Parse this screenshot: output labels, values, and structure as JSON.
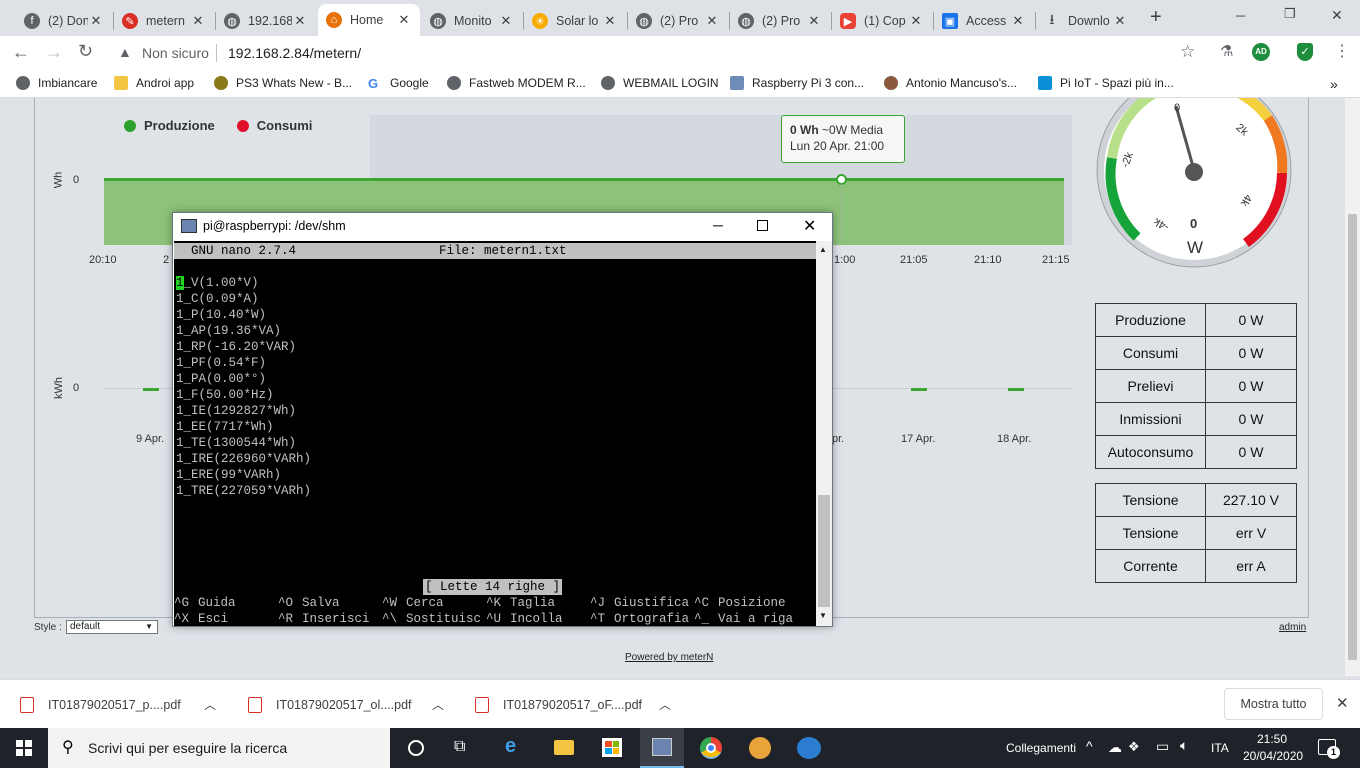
{
  "tabs": [
    {
      "label": "(2) Don",
      "icon": "facebook-icon",
      "color": "#5f6368"
    },
    {
      "label": "metern",
      "icon": "edit-icon",
      "color": "#d93025"
    },
    {
      "label": "192.168",
      "icon": "globe-icon",
      "color": "#5f6368"
    },
    {
      "label": "Home",
      "icon": "home-icon",
      "color": "#e8710a"
    },
    {
      "label": "Monito",
      "icon": "globe-icon",
      "color": "#5f6368"
    },
    {
      "label": "Solar lo",
      "icon": "sun-icon",
      "color": "#f9ab00"
    },
    {
      "label": "(2) Pro",
      "icon": "globe-icon",
      "color": "#5f6368"
    },
    {
      "label": "(2) Pro",
      "icon": "globe-icon",
      "color": "#5f6368"
    },
    {
      "label": "(1) Cop",
      "icon": "youtube-icon",
      "color": "#ea4335"
    },
    {
      "label": "Access",
      "icon": "monitor-icon",
      "color": "#1a73e8"
    },
    {
      "label": "Downlo",
      "icon": "download-icon",
      "color": "#3c4043"
    }
  ],
  "new_tab": "+",
  "window_controls": {
    "minimize": "─",
    "restore": "❐",
    "close": "✕"
  },
  "toolbar": {
    "not_secure": "Non sicuro",
    "url": "192.168.2.84/metern/",
    "profile": "AD"
  },
  "bookmarks": [
    "Imbiancare",
    "Androi app",
    "PS3 Whats New - B...",
    "Google",
    "Fastweb MODEM R...",
    "WEBMAIL LOGIN",
    "Raspberry Pi 3 con...",
    "Antonio Mancuso's...",
    "Pi IoT - Spazi più in..."
  ],
  "bookmarks_more": "»",
  "chart": {
    "legend": [
      {
        "label": "Produzione",
        "color": "#2ca02c"
      },
      {
        "label": "Consumi",
        "color": "#e0102a"
      }
    ],
    "top_ylabel": "Wh",
    "top_ytick": "0",
    "top_xticks_left": [
      "20:10",
      "2"
    ],
    "top_xticks_right": [
      "1:00",
      "21:05",
      "21:10",
      "21:15"
    ],
    "tooltip": {
      "bold": "0 Wh",
      "rest": " ~0W Media",
      "line2": "Lun 20 Apr. 21:00"
    },
    "bottom_ylabel": "kWh",
    "bottom_ytick": "0",
    "bottom_xticks_left": [
      "9 Apr."
    ],
    "bottom_xticks_right": [
      "pr.",
      "17 Apr.",
      "18 Apr."
    ]
  },
  "gauge": {
    "labels": [
      "0",
      "2k",
      "4k",
      "-2k",
      "-4k"
    ],
    "value": "0",
    "unit": "W"
  },
  "table1": [
    [
      "Produzione",
      "0 W"
    ],
    [
      "Consumi",
      "0 W"
    ],
    [
      "Prelievi",
      "0 W"
    ],
    [
      "Inmissioni",
      "0 W"
    ],
    [
      "Autoconsumo",
      "0 W"
    ]
  ],
  "table2": [
    [
      "Tensione",
      "227.10 V"
    ],
    [
      "Tensione",
      "err V"
    ],
    [
      "Corrente",
      "err A"
    ]
  ],
  "style_label": "Style :",
  "style_value": "default",
  "admin_link": "admin",
  "powered_by": "Powered by meterN",
  "terminal": {
    "title": "pi@raspberrypi: /dev/shm",
    "nano_version": "GNU nano 2.7.4",
    "file": "File: metern1.txt",
    "cursor_char": "1",
    "lines": [
      "_V(1.00*V)",
      "1_C(0.09*A)",
      "1_P(10.40*W)",
      "1_AP(19.36*VA)",
      "1_RP(-16.20*VAR)",
      "1_PF(0.54*F)",
      "1_PA(0.00*°)",
      "1_F(50.00*Hz)",
      "1_IE(1292827*Wh)",
      "1_EE(7717*Wh)",
      "1_TE(1300544*Wh)",
      "1_IRE(226960*VARh)",
      "1_ERE(99*VARh)",
      "1_TRE(227059*VARh)"
    ],
    "status": "[ Lette 14 righe ]",
    "shortcuts_row1": [
      [
        "^G",
        "Guida"
      ],
      [
        "^O",
        "Salva"
      ],
      [
        "^W",
        "Cerca"
      ],
      [
        "^K",
        "Taglia"
      ],
      [
        "^J",
        "Giustifica"
      ],
      [
        "^C",
        "Posizione"
      ]
    ],
    "shortcuts_row2": [
      [
        "^X",
        "Esci"
      ],
      [
        "^R",
        "Inserisci"
      ],
      [
        "^\\",
        "Sostituisc"
      ],
      [
        "^U",
        "Incolla"
      ],
      [
        "^T",
        "Ortografia"
      ],
      [
        "^_",
        "Vai a riga"
      ]
    ]
  },
  "downloads": [
    "IT01879020517_p....pdf",
    "IT01879020517_ol....pdf",
    "IT01879020517_oF....pdf"
  ],
  "show_all": "Mostra tutto",
  "taskbar": {
    "search_placeholder": "Scrivi qui per eseguire la ricerca",
    "links_label": "Collegamenti",
    "lang": "ITA",
    "time": "21:50",
    "date": "20/04/2020",
    "notifications": "1"
  }
}
